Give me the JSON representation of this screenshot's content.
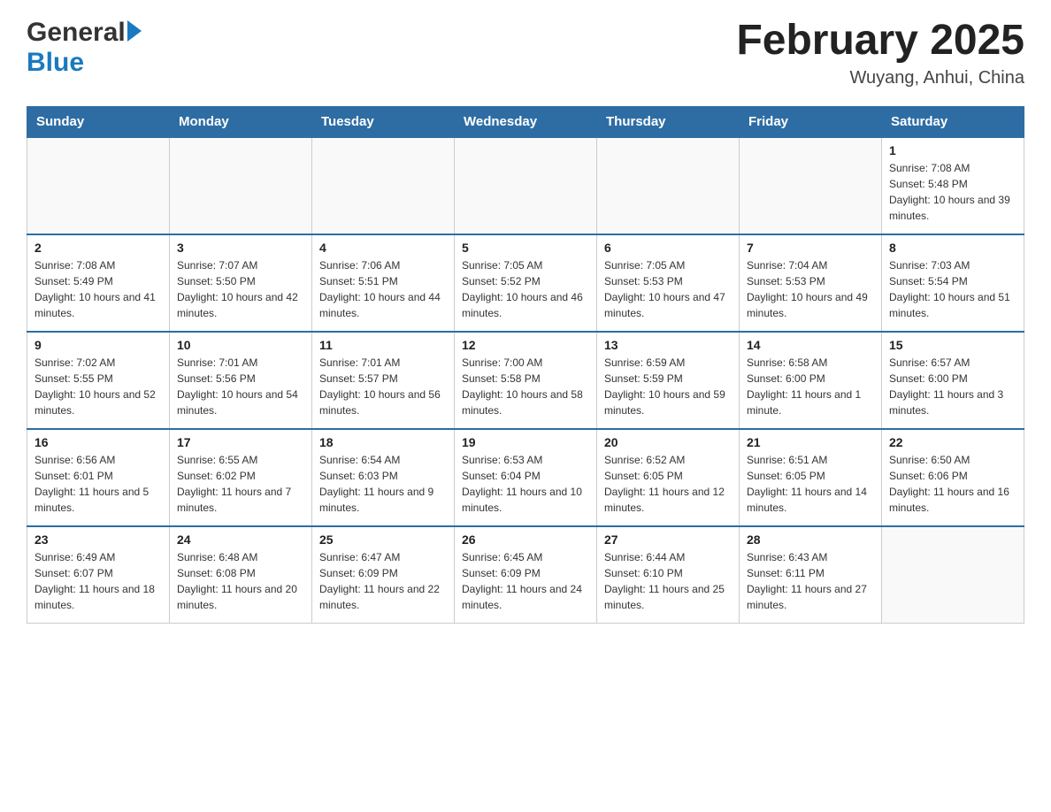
{
  "header": {
    "logo_general": "General",
    "logo_blue": "Blue",
    "month_year": "February 2025",
    "location": "Wuyang, Anhui, China"
  },
  "days_of_week": [
    "Sunday",
    "Monday",
    "Tuesday",
    "Wednesday",
    "Thursday",
    "Friday",
    "Saturday"
  ],
  "weeks": [
    [
      {
        "day": "",
        "sunrise": "",
        "sunset": "",
        "daylight": ""
      },
      {
        "day": "",
        "sunrise": "",
        "sunset": "",
        "daylight": ""
      },
      {
        "day": "",
        "sunrise": "",
        "sunset": "",
        "daylight": ""
      },
      {
        "day": "",
        "sunrise": "",
        "sunset": "",
        "daylight": ""
      },
      {
        "day": "",
        "sunrise": "",
        "sunset": "",
        "daylight": ""
      },
      {
        "day": "",
        "sunrise": "",
        "sunset": "",
        "daylight": ""
      },
      {
        "day": "1",
        "sunrise": "Sunrise: 7:08 AM",
        "sunset": "Sunset: 5:48 PM",
        "daylight": "Daylight: 10 hours and 39 minutes."
      }
    ],
    [
      {
        "day": "2",
        "sunrise": "Sunrise: 7:08 AM",
        "sunset": "Sunset: 5:49 PM",
        "daylight": "Daylight: 10 hours and 41 minutes."
      },
      {
        "day": "3",
        "sunrise": "Sunrise: 7:07 AM",
        "sunset": "Sunset: 5:50 PM",
        "daylight": "Daylight: 10 hours and 42 minutes."
      },
      {
        "day": "4",
        "sunrise": "Sunrise: 7:06 AM",
        "sunset": "Sunset: 5:51 PM",
        "daylight": "Daylight: 10 hours and 44 minutes."
      },
      {
        "day": "5",
        "sunrise": "Sunrise: 7:05 AM",
        "sunset": "Sunset: 5:52 PM",
        "daylight": "Daylight: 10 hours and 46 minutes."
      },
      {
        "day": "6",
        "sunrise": "Sunrise: 7:05 AM",
        "sunset": "Sunset: 5:53 PM",
        "daylight": "Daylight: 10 hours and 47 minutes."
      },
      {
        "day": "7",
        "sunrise": "Sunrise: 7:04 AM",
        "sunset": "Sunset: 5:53 PM",
        "daylight": "Daylight: 10 hours and 49 minutes."
      },
      {
        "day": "8",
        "sunrise": "Sunrise: 7:03 AM",
        "sunset": "Sunset: 5:54 PM",
        "daylight": "Daylight: 10 hours and 51 minutes."
      }
    ],
    [
      {
        "day": "9",
        "sunrise": "Sunrise: 7:02 AM",
        "sunset": "Sunset: 5:55 PM",
        "daylight": "Daylight: 10 hours and 52 minutes."
      },
      {
        "day": "10",
        "sunrise": "Sunrise: 7:01 AM",
        "sunset": "Sunset: 5:56 PM",
        "daylight": "Daylight: 10 hours and 54 minutes."
      },
      {
        "day": "11",
        "sunrise": "Sunrise: 7:01 AM",
        "sunset": "Sunset: 5:57 PM",
        "daylight": "Daylight: 10 hours and 56 minutes."
      },
      {
        "day": "12",
        "sunrise": "Sunrise: 7:00 AM",
        "sunset": "Sunset: 5:58 PM",
        "daylight": "Daylight: 10 hours and 58 minutes."
      },
      {
        "day": "13",
        "sunrise": "Sunrise: 6:59 AM",
        "sunset": "Sunset: 5:59 PM",
        "daylight": "Daylight: 10 hours and 59 minutes."
      },
      {
        "day": "14",
        "sunrise": "Sunrise: 6:58 AM",
        "sunset": "Sunset: 6:00 PM",
        "daylight": "Daylight: 11 hours and 1 minute."
      },
      {
        "day": "15",
        "sunrise": "Sunrise: 6:57 AM",
        "sunset": "Sunset: 6:00 PM",
        "daylight": "Daylight: 11 hours and 3 minutes."
      }
    ],
    [
      {
        "day": "16",
        "sunrise": "Sunrise: 6:56 AM",
        "sunset": "Sunset: 6:01 PM",
        "daylight": "Daylight: 11 hours and 5 minutes."
      },
      {
        "day": "17",
        "sunrise": "Sunrise: 6:55 AM",
        "sunset": "Sunset: 6:02 PM",
        "daylight": "Daylight: 11 hours and 7 minutes."
      },
      {
        "day": "18",
        "sunrise": "Sunrise: 6:54 AM",
        "sunset": "Sunset: 6:03 PM",
        "daylight": "Daylight: 11 hours and 9 minutes."
      },
      {
        "day": "19",
        "sunrise": "Sunrise: 6:53 AM",
        "sunset": "Sunset: 6:04 PM",
        "daylight": "Daylight: 11 hours and 10 minutes."
      },
      {
        "day": "20",
        "sunrise": "Sunrise: 6:52 AM",
        "sunset": "Sunset: 6:05 PM",
        "daylight": "Daylight: 11 hours and 12 minutes."
      },
      {
        "day": "21",
        "sunrise": "Sunrise: 6:51 AM",
        "sunset": "Sunset: 6:05 PM",
        "daylight": "Daylight: 11 hours and 14 minutes."
      },
      {
        "day": "22",
        "sunrise": "Sunrise: 6:50 AM",
        "sunset": "Sunset: 6:06 PM",
        "daylight": "Daylight: 11 hours and 16 minutes."
      }
    ],
    [
      {
        "day": "23",
        "sunrise": "Sunrise: 6:49 AM",
        "sunset": "Sunset: 6:07 PM",
        "daylight": "Daylight: 11 hours and 18 minutes."
      },
      {
        "day": "24",
        "sunrise": "Sunrise: 6:48 AM",
        "sunset": "Sunset: 6:08 PM",
        "daylight": "Daylight: 11 hours and 20 minutes."
      },
      {
        "day": "25",
        "sunrise": "Sunrise: 6:47 AM",
        "sunset": "Sunset: 6:09 PM",
        "daylight": "Daylight: 11 hours and 22 minutes."
      },
      {
        "day": "26",
        "sunrise": "Sunrise: 6:45 AM",
        "sunset": "Sunset: 6:09 PM",
        "daylight": "Daylight: 11 hours and 24 minutes."
      },
      {
        "day": "27",
        "sunrise": "Sunrise: 6:44 AM",
        "sunset": "Sunset: 6:10 PM",
        "daylight": "Daylight: 11 hours and 25 minutes."
      },
      {
        "day": "28",
        "sunrise": "Sunrise: 6:43 AM",
        "sunset": "Sunset: 6:11 PM",
        "daylight": "Daylight: 11 hours and 27 minutes."
      },
      {
        "day": "",
        "sunrise": "",
        "sunset": "",
        "daylight": ""
      }
    ]
  ]
}
